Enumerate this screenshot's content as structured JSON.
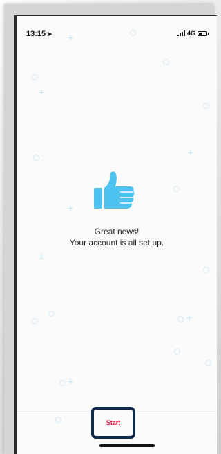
{
  "status_bar": {
    "time": "13:15",
    "location_arrow": "➤",
    "network": "4G"
  },
  "main": {
    "icon": "thumbs-up-icon",
    "headline": "Great news!",
    "subtext": "Your account is all set up."
  },
  "actions": {
    "start_label": "Start"
  },
  "colors": {
    "accent": "#4fc3ef",
    "start_text": "#e1163a",
    "highlight_border": "#0f2a4a"
  }
}
